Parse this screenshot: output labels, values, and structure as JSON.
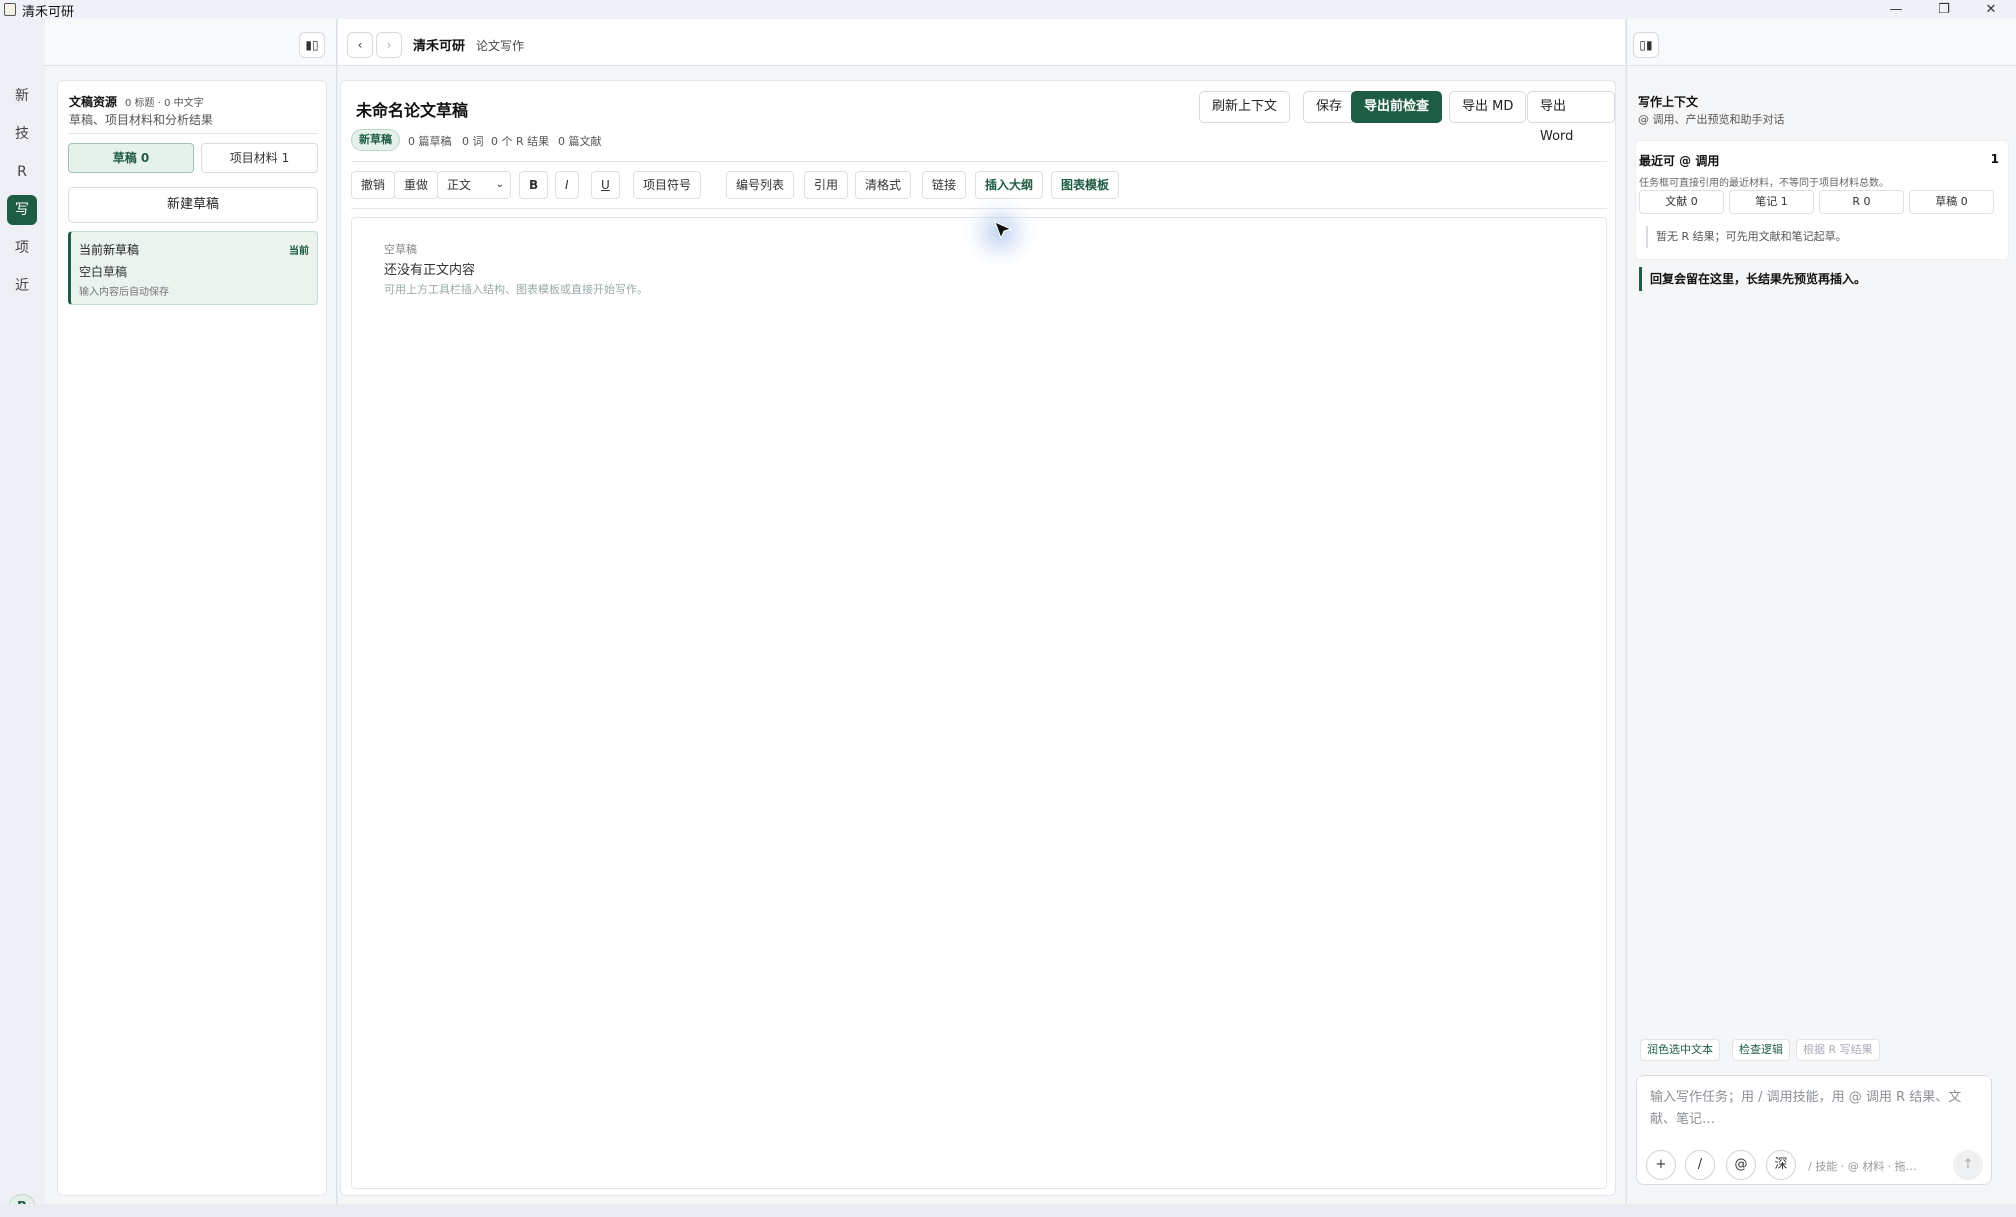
{
  "window": {
    "title": "清禾可研",
    "controls": {
      "minimize": "—",
      "maximize": "❐",
      "close": "✕"
    }
  },
  "rail": {
    "items": [
      "新",
      "技",
      "R",
      "写",
      "项",
      "近"
    ],
    "active_index": 3,
    "avatar": "B"
  },
  "header": {
    "left_toggle": "▮▯",
    "back": "‹",
    "forward": "›",
    "title": "清禾可研",
    "subtitle": "论文写作",
    "right_toggle": "▯▮"
  },
  "resources": {
    "title": "文稿资源",
    "stats": "0 标题 · 0 中文字",
    "subtitle": "草稿、项目材料和分析结果",
    "tabs": [
      "草稿 0",
      "项目材料 1"
    ],
    "new_draft": "新建草稿",
    "current_draft": {
      "title": "当前新草稿",
      "badge": "当前",
      "subtitle": "空白草稿",
      "hint": "输入内容后自动保存"
    }
  },
  "editor": {
    "doc_title": "未命名论文草稿",
    "meta_badge": "新草稿",
    "meta": [
      "0 篇草稿",
      "0 词",
      "0 个 R 结果",
      "0 篇文献"
    ],
    "actions": [
      "刷新上下文",
      "保存",
      "导出前检查",
      "导出 MD",
      "导出 Word"
    ],
    "toolbar": [
      "撤销",
      "重做",
      "正文",
      "B",
      "I",
      "U",
      "项目符号",
      "编号列表",
      "引用",
      "清格式",
      "链接",
      "插入大纲",
      "图表模板"
    ],
    "empty_kicker": "空草稿",
    "empty_title": "还没有正文内容",
    "empty_hint": "可用上方工具栏插入结构、图表模板或直接开始写作。"
  },
  "context": {
    "title": "写作上下文",
    "subtitle": "@ 调用、产出预览和助手对话",
    "recent_title": "最近可 @ 调用",
    "recent_count": "1",
    "recent_sub": "任务框可直接引用的最近材料，不等同于项目材料总数。",
    "chips": [
      "文献 0",
      "笔记 1",
      "R 0",
      "草稿 0"
    ],
    "recent_note": "暂无 R 结果；可先用文献和笔记起草。",
    "reply_note": "回复会留在这里，长结果先预览再插入。",
    "suggestions": [
      "润色选中文本",
      "检查逻辑",
      "根据 R 写结果"
    ],
    "input_placeholder": "输入写作任务；用 / 调用技能，用 @ 调用 R 结果、文献、笔记…",
    "input_buttons": [
      "+",
      "/",
      "@",
      "深"
    ],
    "input_hints": "/ 技能 · @ 材料 · 拖…",
    "send": "↑"
  },
  "colors": {
    "accent": "#1e5d43",
    "accent_light": "#e6f1ec"
  }
}
